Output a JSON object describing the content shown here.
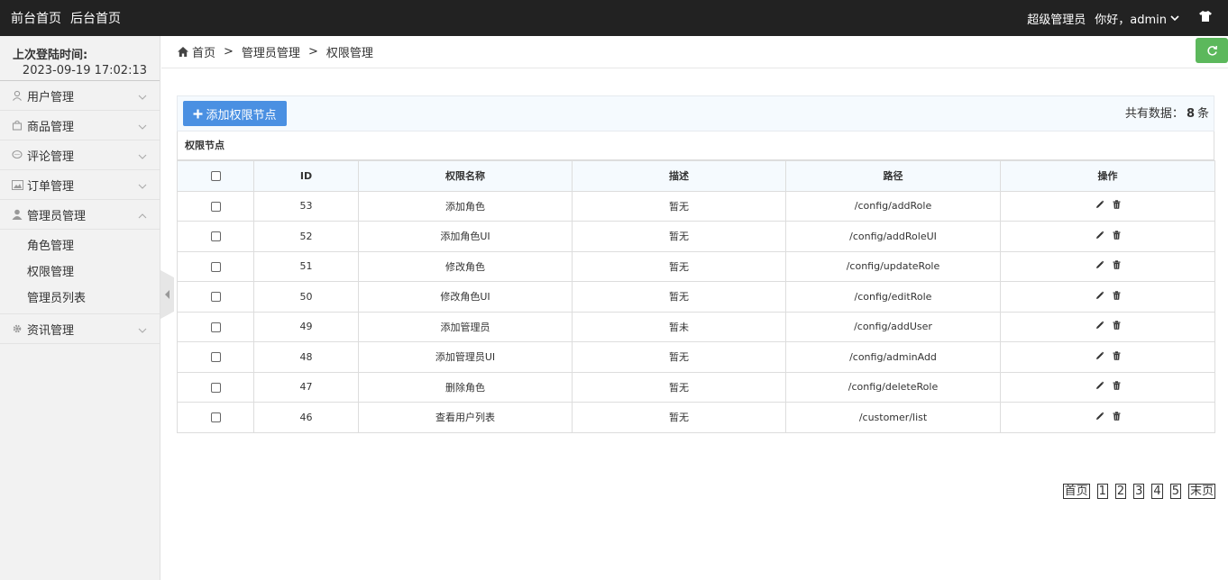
{
  "navbar": {
    "front_home": "前台首页",
    "back_home": "后台首页",
    "role": "超级管理员",
    "greeting": "你好，admin"
  },
  "sidebar": {
    "login_label": "上次登陆时间:",
    "login_time": "2023-09-19 17:02:13",
    "menus": [
      {
        "label": "用户管理",
        "icon": "user-icon"
      },
      {
        "label": "商品管理",
        "icon": "shopping-bag-icon"
      },
      {
        "label": "评论管理",
        "icon": "comment-icon"
      },
      {
        "label": "订单管理",
        "icon": "image-icon"
      },
      {
        "label": "管理员管理",
        "icon": "admin-icon"
      },
      {
        "label": "资讯管理",
        "icon": "gear-icon"
      }
    ],
    "sub_items": [
      "角色管理",
      "权限管理",
      "管理员列表"
    ]
  },
  "breadcrumb": {
    "home": "首页",
    "sep": ">",
    "level1": "管理员管理",
    "level2": "权限管理"
  },
  "toolbar": {
    "add_label": "添加权限节点",
    "count_prefix": "共有数据：",
    "count_value": "8",
    "count_suffix": "条"
  },
  "table": {
    "caption": "权限节点",
    "headers": [
      "ID",
      "权限名称",
      "描述",
      "路径",
      "操作"
    ],
    "rows": [
      {
        "id": "53",
        "name": "添加角色",
        "desc": "暂无",
        "path": "/config/addRole"
      },
      {
        "id": "52",
        "name": "添加角色UI",
        "desc": "暂无",
        "path": "/config/addRoleUI"
      },
      {
        "id": "51",
        "name": "修改角色",
        "desc": "暂无",
        "path": "/config/updateRole"
      },
      {
        "id": "50",
        "name": "修改角色UI",
        "desc": "暂无",
        "path": "/config/editRole"
      },
      {
        "id": "49",
        "name": "添加管理员",
        "desc": "暂未",
        "path": "/config/addUser"
      },
      {
        "id": "48",
        "name": "添加管理员UI",
        "desc": "暂无",
        "path": "/config/adminAdd"
      },
      {
        "id": "47",
        "name": "删除角色",
        "desc": "暂无",
        "path": "/config/deleteRole"
      },
      {
        "id": "46",
        "name": "查看用户列表",
        "desc": "暂无",
        "path": "/customer/list"
      }
    ]
  },
  "pager": {
    "first": "首页",
    "pages": [
      "1",
      "2",
      "3",
      "4",
      "5"
    ],
    "last": "末页"
  },
  "colors": {
    "navbar_bg": "#222222",
    "add_button": "#4a90e2",
    "refresh_button": "#5cb85c"
  }
}
